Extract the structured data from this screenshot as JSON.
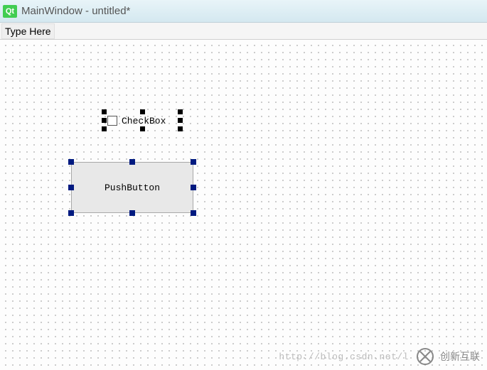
{
  "window": {
    "qt_icon_label": "Qt",
    "title": "MainWindow - untitled*"
  },
  "menu": {
    "type_here": "Type Here"
  },
  "widgets": {
    "checkbox": {
      "label": "CheckBox"
    },
    "pushbutton": {
      "label": "PushButton"
    }
  },
  "watermark": {
    "url": "http://blog.csdn.net/l",
    "brand": "创新互联"
  }
}
